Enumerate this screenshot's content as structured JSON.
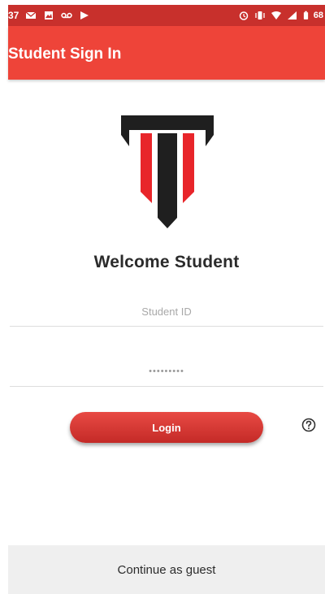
{
  "status_bar": {
    "time": "37",
    "battery": "68",
    "background": "#c8302c",
    "left_icons": [
      "mail-icon",
      "gallery-icon",
      "voicemail-icon",
      "play-store-icon"
    ],
    "right_icons": [
      "alarm-icon",
      "vibrate-icon",
      "wifi-icon",
      "signal-icon",
      "battery-icon"
    ]
  },
  "app_bar": {
    "title": "Student Sign In",
    "background": "#ee4439"
  },
  "logo": {
    "icon": "university-shield-logo",
    "colors": {
      "dark": "#1f1f1f",
      "red": "#e8252a"
    }
  },
  "welcome": {
    "heading": "Welcome Student"
  },
  "form": {
    "student_id": {
      "value": "",
      "placeholder": "Student ID"
    },
    "password": {
      "value": "•••••••••",
      "placeholder": ""
    },
    "login_label": "Login"
  },
  "help": {
    "icon": "help-icon"
  },
  "guest": {
    "label": "Continue as guest"
  }
}
